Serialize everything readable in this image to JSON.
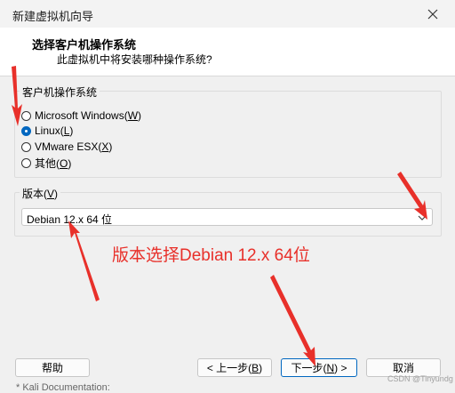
{
  "window": {
    "title": "新建虚拟机向导"
  },
  "header": {
    "heading": "选择客户机操作系统",
    "subheading": "此虚拟机中将安装哪种操作系统?"
  },
  "os_group": {
    "label": "客户机操作系统",
    "options": [
      {
        "label": "Microsoft Windows(",
        "key": "W",
        "suffix": ")",
        "checked": false
      },
      {
        "label": "Linux(",
        "key": "L",
        "suffix": ")",
        "checked": true
      },
      {
        "label": "VMware ESX(",
        "key": "X",
        "suffix": ")",
        "checked": false
      },
      {
        "label": "其他(",
        "key": "O",
        "suffix": ")",
        "checked": false
      }
    ]
  },
  "version_group": {
    "label": "版本(",
    "key": "V",
    "suffix": ")",
    "selected": "Debian 12.x 64 位"
  },
  "annotation": "版本选择Debian 12.x 64位",
  "buttons": {
    "help": "帮助",
    "back": {
      "pre": "< 上一步(",
      "key": "B",
      "post": ")"
    },
    "next": {
      "pre": "下一步(",
      "key": "N",
      "post": ") >"
    },
    "cancel": "取消"
  },
  "background_text": "* Kali Documentation:",
  "watermark": "CSDN @Tinyundg",
  "colors": {
    "accent": "#0067c0",
    "arrow": "#e8302a"
  }
}
